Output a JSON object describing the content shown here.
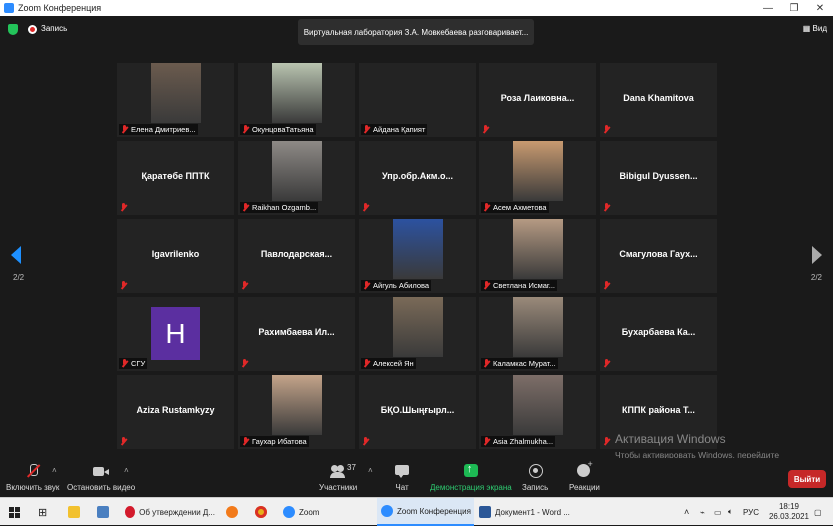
{
  "window": {
    "title": "Zoom Конференция"
  },
  "recording": {
    "label": "Запись"
  },
  "speaker_banner": "Виртуальная лаборатория З.А. Мовкебаева разговаривает...",
  "view_button": "Вид",
  "paging": {
    "current": "2/2"
  },
  "participants": [
    {
      "name": "Елена Дмитриев...",
      "video": true,
      "photo_color": "#6b5b4e"
    },
    {
      "name": "ОкунцоваТатьяна",
      "video": true,
      "photo_color": "#b9c4b0"
    },
    {
      "name": "Айдана Қапият",
      "video": false
    },
    {
      "name": "Роза  Лаиковна...",
      "video": false,
      "big_name": true
    },
    {
      "name": "Dana Khamitova",
      "video": false,
      "big_name": true
    },
    {
      "name": "Қаратөбе ППТК",
      "video": false,
      "big_name": true
    },
    {
      "name": "Raikhan Ozgamb...",
      "video": true,
      "photo_color": "#8e8a86"
    },
    {
      "name": "Упр.обр.Акм.о...",
      "video": false,
      "big_name": true
    },
    {
      "name": "Асем Ахметова",
      "video": true,
      "photo_color": "#c89a70"
    },
    {
      "name": "Bibigul  Dyussen...",
      "video": false,
      "big_name": true
    },
    {
      "name": "Igavrilenko",
      "video": false,
      "big_name": true
    },
    {
      "name": "Павлодарская...",
      "video": false,
      "big_name": true
    },
    {
      "name": "Айгуль Абилова",
      "video": true,
      "photo_color": "#2c52a0"
    },
    {
      "name": "Светлана Исмаг...",
      "video": true,
      "photo_color": "#b59a83"
    },
    {
      "name": "Смагулова  Гаух...",
      "video": false,
      "big_name": true
    },
    {
      "name": "СГУ",
      "video": false,
      "avatar_letter": "H"
    },
    {
      "name": "Рахимбаева  Ил...",
      "video": false,
      "big_name": true
    },
    {
      "name": "Алексей Ян",
      "video": true,
      "photo_color": "#7a6a58"
    },
    {
      "name": "Каламкас Мурат...",
      "video": true,
      "photo_color": "#9a8a7a"
    },
    {
      "name": "Бухарбаева  Ка...",
      "video": false,
      "big_name": true
    },
    {
      "name": "Aziza Rustamkyzy",
      "video": false,
      "big_name": true
    },
    {
      "name": "Гаухар Ибатова",
      "video": true,
      "photo_color": "#c4a48a"
    },
    {
      "name": "БҚО.Шыңғырл...",
      "video": false,
      "big_name": true
    },
    {
      "name": "Asia Zhalmukha...",
      "video": true,
      "photo_color": "#7d6e68"
    },
    {
      "name": "КППК  района  Т...",
      "video": false,
      "big_name": true
    }
  ],
  "toolbar": {
    "mute": "Включить звук",
    "video": "Остановить видео",
    "participants": "Участники",
    "participants_count": "37",
    "chat": "Чат",
    "share": "Демонстрация экрана",
    "record": "Запись",
    "reactions": "Реакции",
    "leave": "Выйти"
  },
  "activation": {
    "title": "Активация Windows",
    "text": "Чтобы активировать Windows, перейдите в раздел \"Параметры\"."
  },
  "taskbar": {
    "opera_item": "Об утверждении Д...",
    "zoom_item": "Zoom",
    "zoom_conf_item": "Zoom Конференция",
    "word_item": "Документ1 - Word ...",
    "lang": "РУС",
    "time": "18:19",
    "date": "26.03.2021"
  }
}
